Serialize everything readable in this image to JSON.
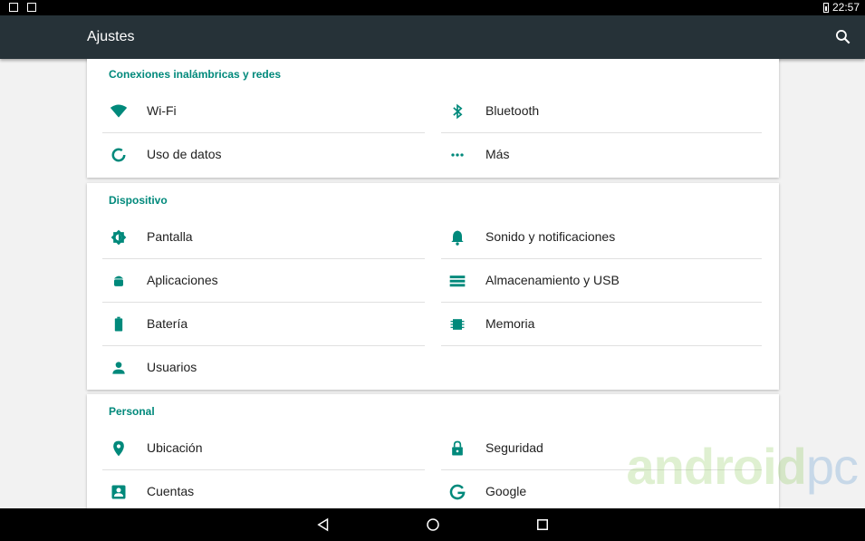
{
  "status_bar": {
    "time": "22:57"
  },
  "toolbar": {
    "title": "Ajustes"
  },
  "accent_color": "#00897b",
  "toolbar_color": "#263238",
  "sections": {
    "wireless": {
      "title": "Conexiones inalámbricas y redes",
      "items": [
        {
          "label": "Wi-Fi",
          "icon": "wifi-icon"
        },
        {
          "label": "Bluetooth",
          "icon": "bluetooth-icon"
        },
        {
          "label": "Uso de datos",
          "icon": "data-usage-icon"
        },
        {
          "label": "Más",
          "icon": "more-icon"
        }
      ]
    },
    "device": {
      "title": "Dispositivo",
      "items": [
        {
          "label": "Pantalla",
          "icon": "brightness-icon"
        },
        {
          "label": "Sonido y notificaciones",
          "icon": "bell-icon"
        },
        {
          "label": "Aplicaciones",
          "icon": "android-icon"
        },
        {
          "label": "Almacenamiento y USB",
          "icon": "storage-icon"
        },
        {
          "label": "Batería",
          "icon": "battery-icon"
        },
        {
          "label": "Memoria",
          "icon": "memory-icon"
        },
        {
          "label": "Usuarios",
          "icon": "person-icon"
        }
      ]
    },
    "personal": {
      "title": "Personal",
      "items": [
        {
          "label": "Ubicación",
          "icon": "location-icon"
        },
        {
          "label": "Seguridad",
          "icon": "lock-icon"
        },
        {
          "label": "Cuentas",
          "icon": "account-box-icon"
        },
        {
          "label": "Google",
          "icon": "google-icon"
        }
      ]
    }
  },
  "watermark": {
    "main": "android",
    "suffix": "pc"
  }
}
